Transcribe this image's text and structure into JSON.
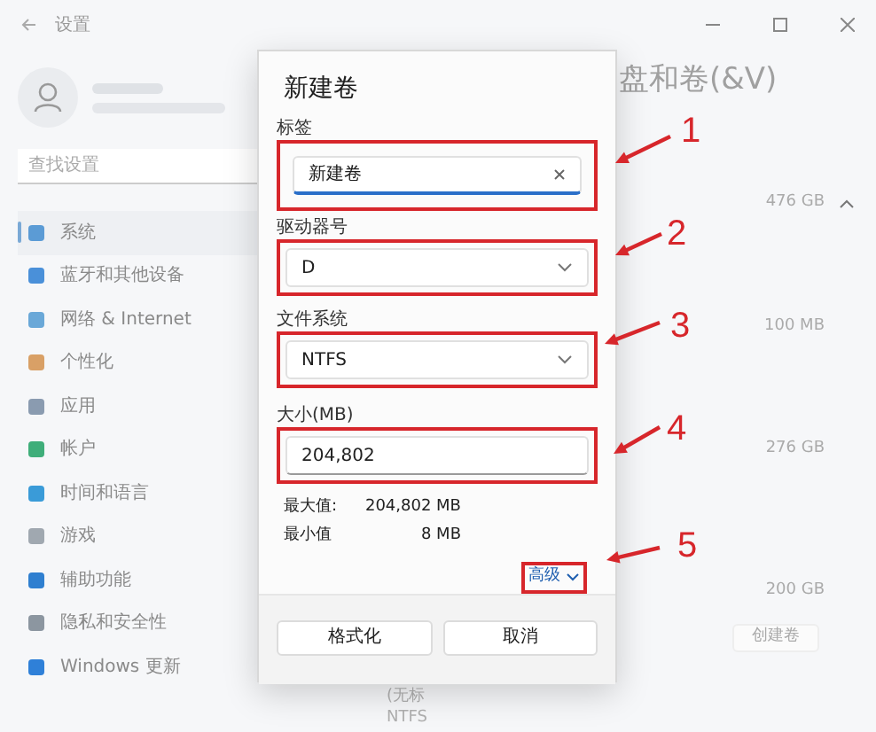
{
  "window": {
    "title": "设置"
  },
  "sidebar": {
    "search": {
      "placeholder": "查找设置"
    },
    "items": [
      {
        "label": "系统",
        "selected": true,
        "color": "#5b9bd5"
      },
      {
        "label": "蓝牙和其他设备",
        "selected": false,
        "color": "#4a90d9"
      },
      {
        "label": "网络 & Internet",
        "selected": false,
        "color": "#6aa8d8"
      },
      {
        "label": "个性化",
        "selected": false,
        "color": "#d9a066"
      },
      {
        "label": "应用",
        "selected": false,
        "color": "#8a9bb0"
      },
      {
        "label": "帐户",
        "selected": false,
        "color": "#3fae7a"
      },
      {
        "label": "时间和语言",
        "selected": false,
        "color": "#3a9bd8"
      },
      {
        "label": "游戏",
        "selected": false,
        "color": "#a0a8b0"
      },
      {
        "label": "辅助功能",
        "selected": false,
        "color": "#2f7fd0"
      },
      {
        "label": "隐私和安全性",
        "selected": false,
        "color": "#8c96a0"
      },
      {
        "label": "Windows 更新",
        "selected": false,
        "color": "#2f80d8"
      }
    ]
  },
  "content": {
    "heading": "盘和卷(&V)",
    "sizes": [
      "476 GB",
      "100 MB",
      "276 GB",
      "200 GB"
    ],
    "create_button": "创建卷",
    "partial_lines": [
      "(无标",
      "NTFS"
    ]
  },
  "dialog": {
    "title": "新建卷",
    "fields": [
      {
        "kind": "text",
        "label": "标签",
        "value": "新建卷",
        "focused": true
      },
      {
        "kind": "select",
        "label": "驱动器号",
        "value": "D",
        "focused": false
      },
      {
        "kind": "select",
        "label": "文件系统",
        "value": "NTFS",
        "focused": false
      },
      {
        "kind": "text",
        "label": "大小(MB)",
        "value": "204,802",
        "focused": false
      }
    ],
    "limits": [
      {
        "label": "最大值:",
        "value": "204,802 MB"
      },
      {
        "label": "最小值",
        "value": "8 MB"
      }
    ],
    "advanced": "高级",
    "buttons": [
      "格式化",
      "取消"
    ]
  },
  "annotations": [
    "1",
    "2",
    "3",
    "4",
    "5"
  ]
}
